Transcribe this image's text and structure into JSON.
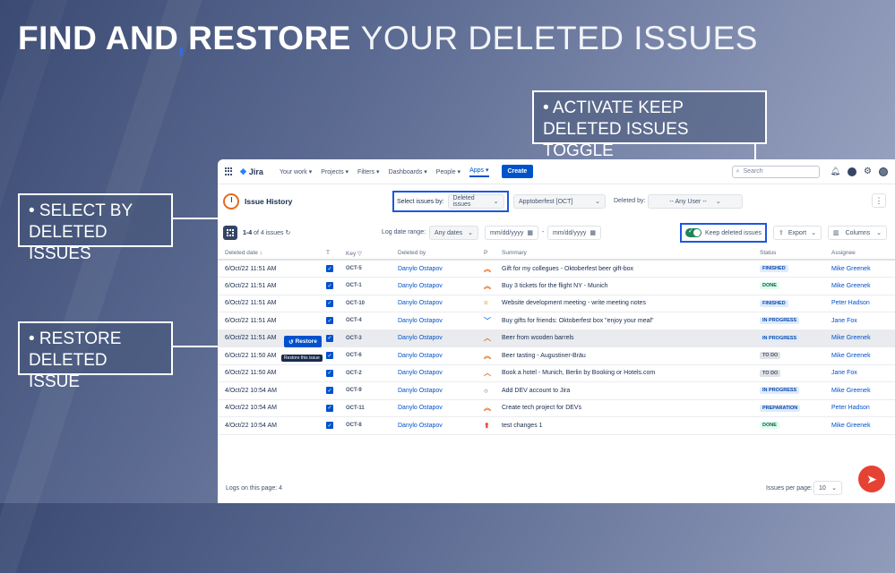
{
  "headline": {
    "highlight": "FIND AND RESTORE",
    "rest": "YOUR DELETED ISSUES"
  },
  "callouts": {
    "select": "• SELECT BY DELETED ISSUES",
    "restore": "• RESTORE DELETED ISSUE",
    "activate": "• ACTIVATE KEEP DELETED ISSUES TOGGLE"
  },
  "topbar": {
    "logo": "Jira",
    "nav": [
      "Your work",
      "Projects",
      "Filters",
      "Dashboards",
      "People",
      "Apps"
    ],
    "create": "Create",
    "search_placeholder": "Search"
  },
  "header": {
    "title": "Issue History",
    "select_label": "Select issues by:",
    "select_value": "Deleted issues",
    "sprint_value": "Apptoberfest [OCT]",
    "deleted_by_label": "Deleted by:",
    "deleted_by_value": "-- Any User --"
  },
  "toolbar": {
    "count_range": "1-4",
    "count_text": "of 4 issues",
    "log_label": "Log date range:",
    "any_dates": "Any dates",
    "date_placeholder_1": "mm/dd/yyyy",
    "date_sep": "-",
    "date_placeholder_2": "mm/dd/yyyy",
    "keep_label": "Keep deleted issues",
    "export": "Export",
    "columns": "Columns"
  },
  "table": {
    "headers": [
      "Deleted date ↓",
      "T",
      "Key",
      "Deleted by",
      "P",
      "Summary",
      "Status",
      "Assignee"
    ],
    "rows": [
      {
        "date": "6/Oct/22 11:51 AM",
        "key": "OCT-5",
        "by": "Danylo Ostapov",
        "p": "︽",
        "pc": "#e36b1c",
        "summary": "Gift for my collegues - Oktoberfest beer gift-box",
        "status": "FINISHED",
        "sc": "lz-finished",
        "assignee": "Mike Greenek"
      },
      {
        "date": "6/Oct/22 11:51 AM",
        "key": "OCT-1",
        "by": "Danylo Ostapov",
        "p": "︽",
        "pc": "#e36b1c",
        "summary": "Buy 3 tickets for the flight NY - Munich",
        "status": "DONE",
        "sc": "lz-done",
        "assignee": "Mike Greenek"
      },
      {
        "date": "6/Oct/22 11:51 AM",
        "key": "OCT-10",
        "by": "Danylo Ostapov",
        "p": "=",
        "pc": "#f29d38",
        "summary": "Website development meeting - write meeting notes",
        "status": "FINISHED",
        "sc": "lz-finished",
        "assignee": "Peter Hadson"
      },
      {
        "date": "6/Oct/22 11:51 AM",
        "key": "OCT-4",
        "by": "Danylo Ostapov",
        "p": "﹀",
        "pc": "#2684ff",
        "summary": "Buy gifts for friends: Oktoberfest box \"enjoy your meal\"",
        "status": "IN PROGRESS",
        "sc": "lz-progress",
        "assignee": "Jane Fox"
      },
      {
        "date": "6/Oct/22 11:51 AM",
        "key": "OCT-3",
        "by": "Danylo Ostapov",
        "p": "︿",
        "pc": "#e36b1c",
        "summary": "Beer from wooden barrels",
        "status": "IN PROGRESS",
        "sc": "lz-progress",
        "assignee": "Mike Greenek"
      },
      {
        "date": "6/Oct/22 11:50 AM",
        "key": "OCT-6",
        "by": "Danylo Ostapov",
        "p": "︽",
        "pc": "#e36b1c",
        "summary": "Beer tasting - Augustiner-Bräu",
        "status": "TO DO",
        "sc": "lz-todo",
        "assignee": "Mike Greenek"
      },
      {
        "date": "6/Oct/22 11:50 AM",
        "key": "OCT-2",
        "by": "Danylo Ostapov",
        "p": "︿",
        "pc": "#e36b1c",
        "summary": "Book a hotel - Munich, Berlin by Booking or Hotels.com",
        "status": "TO DO",
        "sc": "lz-todo",
        "assignee": "Jane Fox"
      },
      {
        "date": "4/Oct/22 10:54 AM",
        "key": "OCT-9",
        "by": "Danylo Ostapov",
        "p": "○",
        "pc": "#42526e",
        "summary": "Add DEV account to Jira",
        "status": "IN PROGRESS",
        "sc": "lz-progress",
        "assignee": "Mike Greenek"
      },
      {
        "date": "4/Oct/22 10:54 AM",
        "key": "OCT-11",
        "by": "Danylo Ostapov",
        "p": "︽",
        "pc": "#e36b1c",
        "summary": "Create tech project for DEVs",
        "status": "PREPARATION",
        "sc": "lz-prep",
        "assignee": "Peter Hadson"
      },
      {
        "date": "4/Oct/22 10:54 AM",
        "key": "OCT-8",
        "by": "Danylo Ostapov",
        "p": "⬆",
        "pc": "#e64234",
        "summary": "test changes 1",
        "status": "DONE",
        "sc": "lz-done",
        "assignee": "Mike Greenek"
      }
    ]
  },
  "restore": {
    "button": "Restore",
    "tooltip": "Restore this issue"
  },
  "footer": {
    "logs": "Logs on this page: 4",
    "per_page_label": "Issues per page:",
    "per_page_value": "10"
  }
}
